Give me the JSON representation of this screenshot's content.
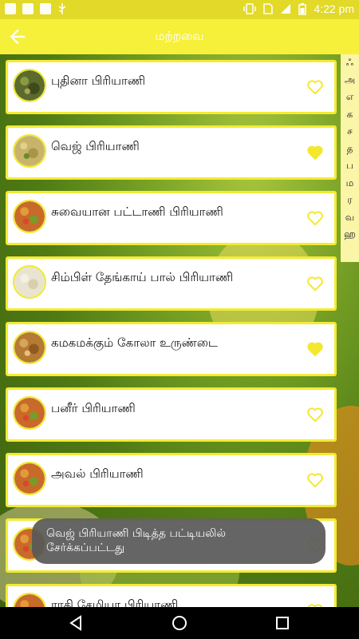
{
  "status_bar": {
    "time": "4:22 pm",
    "icons": [
      "notification-icon",
      "image-icon",
      "square-icon",
      "usb-icon",
      "vibrate-icon",
      "sim-icon",
      "signal-icon",
      "battery-icon"
    ]
  },
  "app_bar": {
    "title": "மற்றவை",
    "back_icon": "arrow-left-icon"
  },
  "recipes": [
    {
      "name": "புதினா பிரியாணி",
      "favorite": false,
      "thumb_color": "#5b6b2c"
    },
    {
      "name": "வெஜ் பிரியாணி",
      "favorite": true,
      "thumb_color": "#c7b46a"
    },
    {
      "name": "சுவையான பட்டாணி பிரியாணி",
      "favorite": false,
      "thumb_color": "#c86a2a"
    },
    {
      "name": "சிம்பிள் தேங்காய் பால் பிரியாணி",
      "favorite": false,
      "thumb_color": "#e9e4cf"
    },
    {
      "name": "கமகமக்கும் கோலா உருண்டை",
      "favorite": true,
      "thumb_color": "#b57a34"
    },
    {
      "name": "பனீர் பிரியாணி",
      "favorite": false,
      "thumb_color": "#c86a2a"
    },
    {
      "name": "அவல் பிரியாணி",
      "favorite": false,
      "thumb_color": "#c86a2a"
    },
    {
      "name": "",
      "favorite": false,
      "thumb_color": "#c86a2a"
    },
    {
      "name": "ராகி சேமியா பிரியாணி",
      "favorite": false,
      "thumb_color": "#c86a2a"
    }
  ],
  "alphabet_index": [
    "ஃ",
    "அ",
    "எ",
    "க",
    "ச",
    "த",
    "ப",
    "ம",
    "ர",
    "வ",
    "ஹ"
  ],
  "toast": {
    "line1": "வெஜ் பிரியாணி பிடித்த பட்டியலில்",
    "line2": "சேர்க்கப்பட்டது"
  },
  "colors": {
    "accent": "#f7f03a",
    "status_bar": "#e2d928",
    "heart": "#f3e82e"
  },
  "nav_bar": {
    "icons": [
      "back-triangle-icon",
      "home-circle-icon",
      "recents-square-icon"
    ]
  }
}
